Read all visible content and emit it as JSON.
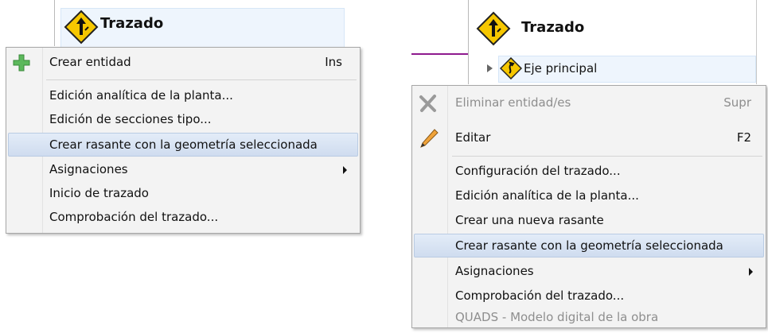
{
  "left": {
    "tree_title": "Trazado",
    "menu": {
      "items": [
        {
          "label": "Crear entidad",
          "shortcut": "Ins",
          "icon": "plus-icon",
          "state": "normal"
        },
        {
          "label": "Edición analítica de la planta...",
          "state": "normal"
        },
        {
          "label": "Edición de secciones tipo...",
          "state": "normal"
        },
        {
          "label": "Crear rasante con la geometría seleccionada",
          "state": "highlighted"
        },
        {
          "label": "Asignaciones",
          "submenu": true,
          "state": "normal"
        },
        {
          "label": "Inicio de trazado",
          "state": "normal"
        },
        {
          "label": "Comprobación del trazado...",
          "state": "normal"
        }
      ]
    }
  },
  "right": {
    "tree_title": "Trazado",
    "tree_child": "Eje principal",
    "menu": {
      "items": [
        {
          "label": "Eliminar entidad/es",
          "shortcut": "Supr",
          "icon": "x-delete-icon",
          "state": "disabled"
        },
        {
          "label": "Editar",
          "shortcut": "F2",
          "icon": "pencil-icon",
          "state": "normal"
        },
        {
          "label": "Configuración del trazado...",
          "state": "normal"
        },
        {
          "label": "Edición analítica de la planta...",
          "state": "normal"
        },
        {
          "label": "Crear una nueva rasante",
          "state": "normal"
        },
        {
          "label": "Crear rasante con la geometría seleccionada",
          "state": "highlighted"
        },
        {
          "label": "Asignaciones",
          "submenu": true,
          "state": "normal"
        },
        {
          "label": "Comprobación del trazado...",
          "state": "normal"
        },
        {
          "label": "QUADS - Modelo digital de la obra",
          "state": "disabled"
        }
      ]
    }
  },
  "colors": {
    "sign_yellow": "#f6c700",
    "highlight": "#cfdcef",
    "menu_bg": "#f3f3f3",
    "plus_green": "#5cb85c",
    "magenta_line": "#8e1a8e"
  }
}
